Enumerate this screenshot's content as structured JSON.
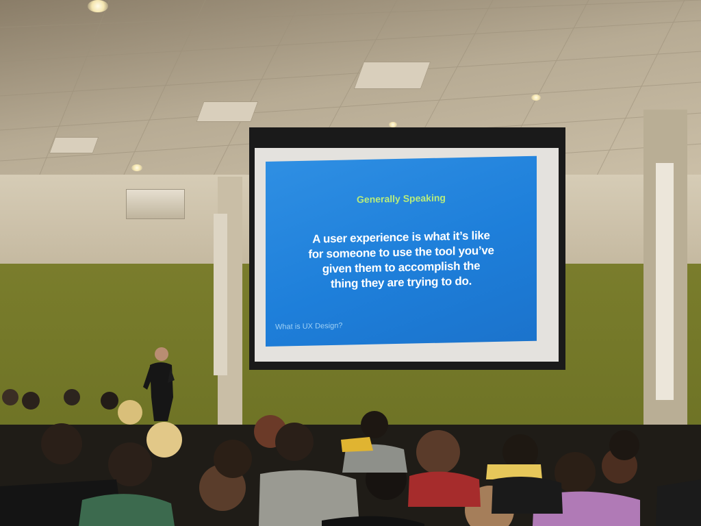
{
  "slide": {
    "title": "Generally Speaking",
    "body_lines": [
      "A user experience is what it’s like",
      "for someone to use the tool you’ve",
      "given them to accomplish the",
      "thing they are trying to do."
    ],
    "footer": "What is UX Design?"
  },
  "colors": {
    "slide_bg": "#1e7fda",
    "slide_title": "#b8ec7c",
    "slide_text": "#ffffff",
    "wall_green": "#6f7426"
  }
}
